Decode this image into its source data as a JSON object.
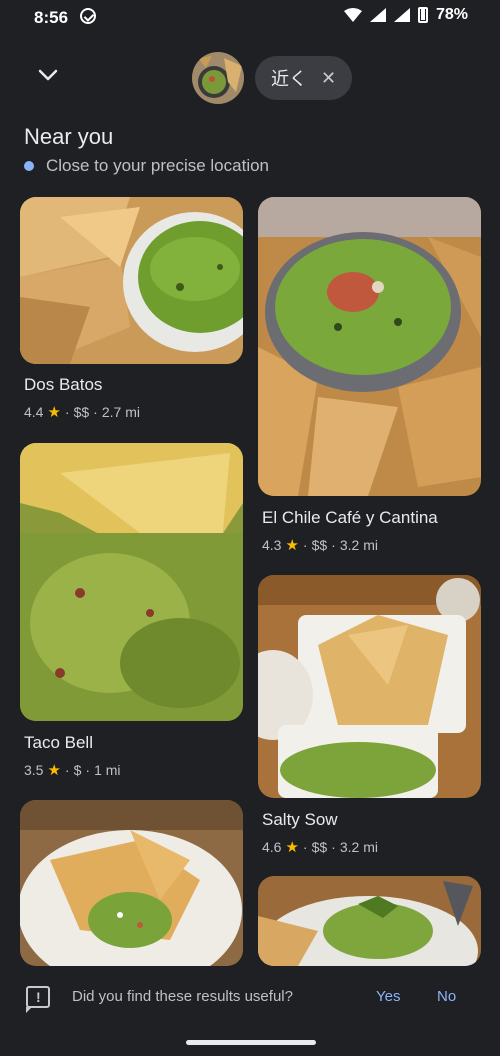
{
  "status": {
    "time": "8:56",
    "battery": "78%"
  },
  "header": {
    "filter_chip": "近く",
    "filter_clear_icon": "close-icon"
  },
  "section": {
    "title": "Near you",
    "subtitle": "Close to your precise location",
    "dot_color": "#8ab4f8"
  },
  "results": [
    {
      "name": "Dos Batos",
      "rating": "4.4",
      "price": "$$",
      "distance": "2.7 mi"
    },
    {
      "name": "El Chile Café y Cantina",
      "rating": "4.3",
      "price": "$$",
      "distance": "3.2 mi"
    },
    {
      "name": "Taco Bell",
      "rating": "3.5",
      "price": "$",
      "distance": "1 mi"
    },
    {
      "name": "Salty Sow",
      "rating": "4.6",
      "price": "$$",
      "distance": "3.2 mi"
    }
  ],
  "feedback": {
    "question": "Did you find these results useful?",
    "yes": "Yes",
    "no": "No"
  },
  "colors": {
    "background": "#1f2024",
    "accent": "#8ab4f8",
    "star": "#fbbc04"
  }
}
